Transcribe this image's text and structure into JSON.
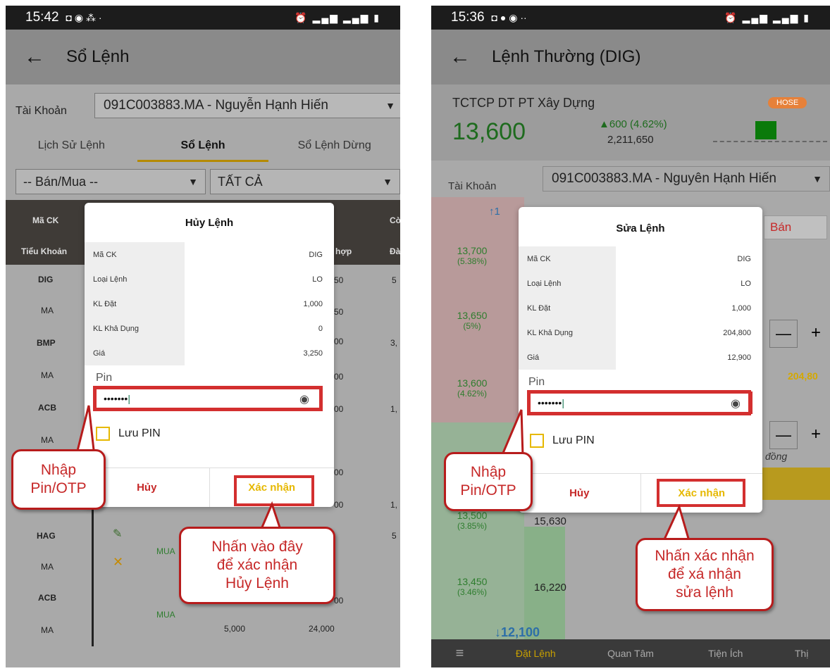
{
  "left": {
    "status_time": "15:42",
    "status_icons": "◘ ◉ ⁂ ·",
    "status_right": "⏰ ▂▄▆ ▂▄▆ ▮",
    "title": "Sổ Lệnh",
    "account_label": "Tài Khoản",
    "account_value": "091C003883.MA - Nguyễn Hạnh Hiến",
    "tabs": [
      "Lịch Sử Lệnh",
      "Sổ Lệnh",
      "Sổ Lệnh Dừng"
    ],
    "filter_side": "-- Bán/Mua --",
    "filter_status": "TẤT CẢ",
    "header": {
      "c1": "Mã CK",
      "c1b": "Tiểu Khoản",
      "c2": "Cò",
      "c2b": "Đà",
      "c3b": "hợp"
    },
    "rows": [
      {
        "code": "DIG",
        "sub": "MA"
      },
      {
        "code": "BMP",
        "sub": "MA"
      },
      {
        "code": "ACB",
        "sub": "MA"
      },
      {
        "code": "HAG",
        "sub": "MA"
      },
      {
        "code": "ACB",
        "sub": "MA"
      }
    ],
    "side_text": "MUA",
    "side_text2": "MUA",
    "bg_vals": [
      "50",
      "50",
      "00",
      "00",
      "00",
      "00",
      "00",
      "00"
    ],
    "bg_right": [
      "5",
      "3,",
      "1,",
      "1,",
      "5"
    ],
    "last_qty": "5,000",
    "last_price": "24,000",
    "dialog": {
      "title": "Hủy Lệnh",
      "rows": [
        {
          "k": "Mã CK",
          "v": "DIG"
        },
        {
          "k": "Loại Lệnh",
          "v": "LO"
        },
        {
          "k": "KL Đặt",
          "v": "1,000"
        },
        {
          "k": "KL Khả Dụng",
          "v": "0"
        },
        {
          "k": "Giá",
          "v": "3,250"
        }
      ],
      "pin_label": "Pin",
      "pin_value": "•••••••",
      "save_pin": "Lưu PIN",
      "cancel": "Hủy",
      "confirm": "Xác nhận"
    },
    "callout_pin": "Nhập\nPin/OTP",
    "callout_confirm": "Nhấn vào đây\nđể xác nhận\nHủy Lệnh"
  },
  "right": {
    "status_time": "15:36",
    "status_icons": "◘ ● ◉ ··",
    "status_right": "⏰ ▂▄▆ ▂▄▆ ▮",
    "title": "Lệnh Thường (DIG)",
    "company": "TCTCP DT PT Xây Dựng",
    "exchange": "HOSE",
    "price": "13,600",
    "change": "▲600 (4.62%)",
    "volume": "2,211,650",
    "account_label": "Tài Khoản",
    "account_value": "091C003883.MA - Nguyên Hạnh Hiến",
    "ceiling": "↑1",
    "sell_tab": "Bán",
    "prices": [
      {
        "p": "13,700",
        "pct": "(5.38%)"
      },
      {
        "p": "13,650",
        "pct": "(5%)"
      },
      {
        "p": "13,600",
        "pct": "(4.62%)"
      },
      {
        "p": "13,500",
        "pct": "(3.85%)"
      },
      {
        "p": "13,450",
        "pct": "(3.46%)"
      }
    ],
    "bid_vols": [
      "15,630",
      "16,220"
    ],
    "floor": "↓12,100",
    "avail": "204,80",
    "unit": "đồng",
    "minus": "—",
    "plus": "+",
    "nav": [
      "Đặt Lệnh",
      "Quan Tâm",
      "Tiện Ích",
      "Thị"
    ],
    "dialog": {
      "title": "Sửa Lệnh",
      "rows": [
        {
          "k": "Mã CK",
          "v": "DIG"
        },
        {
          "k": "Loại Lệnh",
          "v": "LO"
        },
        {
          "k": "KL Đặt",
          "v": "1,000"
        },
        {
          "k": "KL Khả Dụng",
          "v": "204,800"
        },
        {
          "k": "Giá",
          "v": "12,900"
        }
      ],
      "pin_label": "Pin",
      "pin_value": "•••••••",
      "save_pin": "Lưu PIN",
      "cancel": "Hủy",
      "confirm": "Xác nhận"
    },
    "callout_pin": "Nhập\nPin/OTP",
    "callout_confirm": "Nhấn xác nhận\nđể xá nhận\nsửa lệnh"
  },
  "colors": {
    "accent_red": "#d32f2f",
    "confirm_yellow": "#e6b800",
    "hose_orange": "#e65100"
  }
}
